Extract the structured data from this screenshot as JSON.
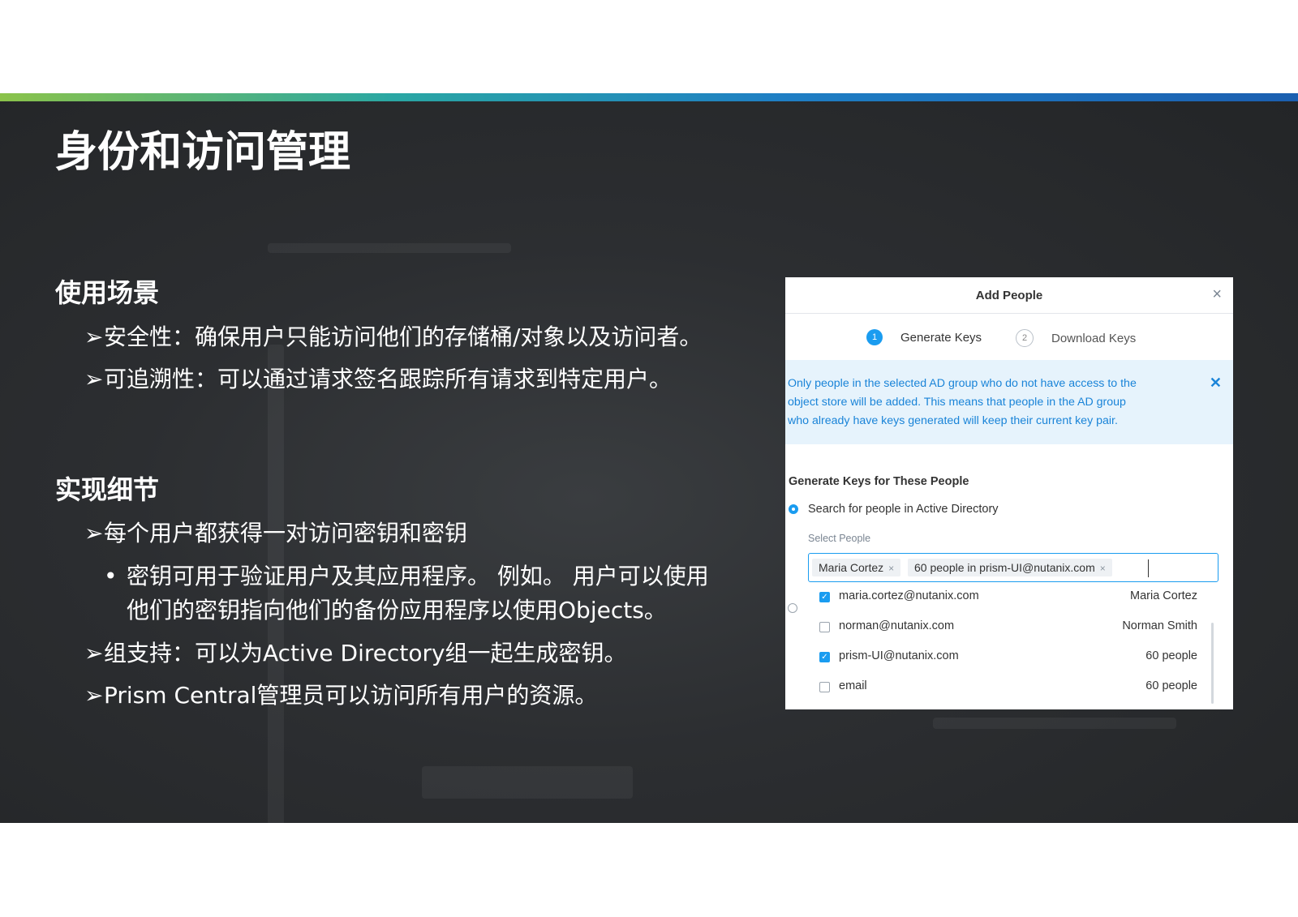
{
  "slide": {
    "title": "身份和访问管理",
    "section1": {
      "heading": "使用场景",
      "bullets": [
        "安全性：确保用户只能访问他们的存储桶/对象以及访问者。",
        "可追溯性：可以通过请求签名跟踪所有请求到特定用户。"
      ]
    },
    "section2": {
      "heading": "实现细节",
      "bullet1": "每个用户都获得一对访问密钥和密钥",
      "sub_line1": "密钥可用于验证用户及其应用程序。 例如。 用户可以使用",
      "sub_line2": "他们的密钥指向他们的备份应用程序以使用Objects。",
      "bullet2": "组支持：可以为Active Directory组一起生成密钥。",
      "bullet3": "Prism Central管理员可以访问所有用户的资源。"
    },
    "arrow": "➢",
    "dot": "•"
  },
  "dialog": {
    "title": "Add People",
    "close": "×",
    "steps": [
      {
        "num": "1",
        "label": "Generate Keys"
      },
      {
        "num": "2",
        "label": "Download Keys"
      }
    ],
    "info_lines": [
      "Only people in the selected AD group who do not have access to the",
      "object store will be added. This means that people in the AD group",
      "who already have keys generated will keep their current key pair."
    ],
    "info_close": "✕",
    "section_title": "Generate Keys for These People",
    "radio_label": "Search for people in Active Directory",
    "select_label": "Select People",
    "tags": [
      "Maria Cortez",
      "60 people in prism-UI@nutanix.com"
    ],
    "tag_remove": "×",
    "rows": [
      {
        "email": "maria.cortez@nutanix.com",
        "name": "Maria Cortez",
        "checked": true
      },
      {
        "email": "norman@nutanix.com",
        "name": "Norman Smith",
        "checked": false
      },
      {
        "email": "prism-UI@nutanix.com",
        "name": "60 people",
        "checked": true
      },
      {
        "email": "email",
        "name": "60 people",
        "checked": false
      }
    ],
    "check_glyph": "✓"
  },
  "colors": {
    "accent": "#1a9cf0",
    "info_text": "#1a84d8",
    "info_bg": "#e6f3fc",
    "slide_bg": "#2c2e31"
  }
}
